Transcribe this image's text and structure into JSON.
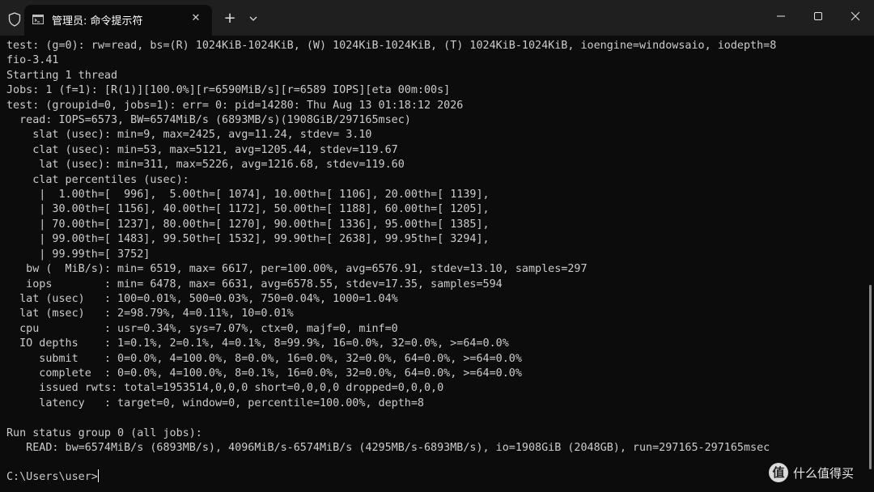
{
  "window": {
    "tab_title": "管理员: 命令提示符",
    "tab_close_glyph": "✕",
    "new_tab_glyph": "+"
  },
  "icons": [
    "shield-icon",
    "cmd-icon",
    "close-icon",
    "plus-icon",
    "chevron-down-icon",
    "minimize-icon",
    "maximize-icon",
    "window-close-icon"
  ],
  "colors": {
    "background": "#0c0c0c",
    "titlebar": "#1f1f1f",
    "text": "#cccccc"
  },
  "terminal": {
    "output": "test: (g=0): rw=read, bs=(R) 1024KiB-1024KiB, (W) 1024KiB-1024KiB, (T) 1024KiB-1024KiB, ioengine=windowsaio, iodepth=8\nfio-3.41\nStarting 1 thread\nJobs: 1 (f=1): [R(1)][100.0%][r=6590MiB/s][r=6589 IOPS][eta 00m:00s]\ntest: (groupid=0, jobs=1): err= 0: pid=14280: Thu Aug 13 01:18:12 2026\n  read: IOPS=6573, BW=6574MiB/s (6893MB/s)(1908GiB/297165msec)\n    slat (usec): min=9, max=2425, avg=11.24, stdev= 3.10\n    clat (usec): min=53, max=5121, avg=1205.44, stdev=119.67\n     lat (usec): min=311, max=5226, avg=1216.68, stdev=119.60\n    clat percentiles (usec):\n     |  1.00th=[  996],  5.00th=[ 1074], 10.00th=[ 1106], 20.00th=[ 1139],\n     | 30.00th=[ 1156], 40.00th=[ 1172], 50.00th=[ 1188], 60.00th=[ 1205],\n     | 70.00th=[ 1237], 80.00th=[ 1270], 90.00th=[ 1336], 95.00th=[ 1385],\n     | 99.00th=[ 1483], 99.50th=[ 1532], 99.90th=[ 2638], 99.95th=[ 3294],\n     | 99.99th=[ 3752]\n   bw (  MiB/s): min= 6519, max= 6617, per=100.00%, avg=6576.91, stdev=13.10, samples=297\n   iops        : min= 6478, max= 6631, avg=6578.55, stdev=17.35, samples=594\n  lat (usec)   : 100=0.01%, 500=0.03%, 750=0.04%, 1000=1.04%\n  lat (msec)   : 2=98.79%, 4=0.11%, 10=0.01%\n  cpu          : usr=0.34%, sys=7.07%, ctx=0, majf=0, minf=0\n  IO depths    : 1=0.1%, 2=0.1%, 4=0.1%, 8=99.9%, 16=0.0%, 32=0.0%, >=64=0.0%\n     submit    : 0=0.0%, 4=100.0%, 8=0.0%, 16=0.0%, 32=0.0%, 64=0.0%, >=64=0.0%\n     complete  : 0=0.0%, 4=100.0%, 8=0.1%, 16=0.0%, 32=0.0%, 64=0.0%, >=64=0.0%\n     issued rwts: total=1953514,0,0,0 short=0,0,0,0 dropped=0,0,0,0\n     latency   : target=0, window=0, percentile=100.00%, depth=8\n\nRun status group 0 (all jobs):\n   READ: bw=6574MiB/s (6893MB/s), 4096MiB/s-6574MiB/s (4295MB/s-6893MB/s), io=1908GiB (2048GB), run=297165-297165msec",
    "prompt": "C:\\Users\\user>"
  },
  "watermark": {
    "logo_glyph": "值",
    "text": "什么值得买"
  }
}
